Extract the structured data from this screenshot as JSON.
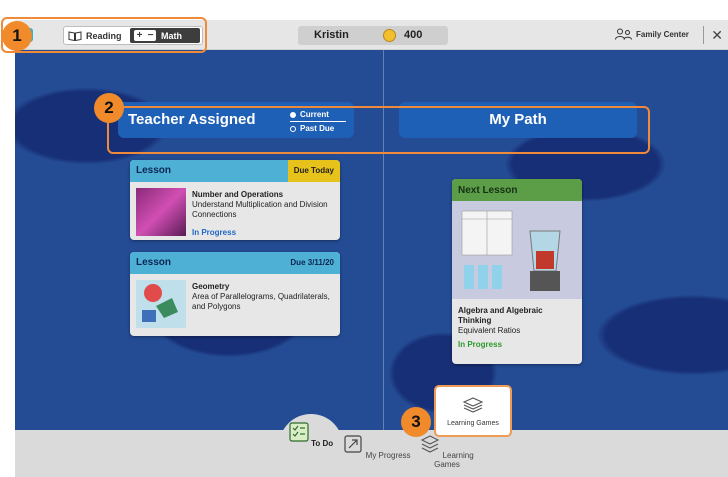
{
  "topbar": {
    "subjects": [
      {
        "label": "Reading",
        "icon": "book-icon",
        "selected": false
      },
      {
        "label": "Math",
        "icon": "plus-minus-icon",
        "selected": true
      }
    ],
    "user_name": "Kristin",
    "coins": "400",
    "family_center_label": "Family Center",
    "close_icon": "close-icon"
  },
  "tabs": {
    "assigned": {
      "label": "Teacher Assigned",
      "options": [
        {
          "label": "Current",
          "selected": true
        },
        {
          "label": "Past Due",
          "selected": false
        }
      ]
    },
    "my_path": {
      "label": "My Path"
    }
  },
  "lessons": [
    {
      "header": "Lesson",
      "due": "Due Today",
      "title": "Number and Operations",
      "subtitle": "Understand Multiplication and Division Connections",
      "status": "In Progress"
    },
    {
      "header": "Lesson",
      "due": "Due 3/11/20",
      "title": "Geometry",
      "subtitle": "Area of Parallelograms, Quadrilaterals, and Polygons",
      "status": ""
    }
  ],
  "next_lesson": {
    "header": "Next Lesson",
    "title": "Algebra and Algebraic Thinking",
    "subtitle": "Equivalent Ratios",
    "status": "In Progress"
  },
  "bottom_nav": [
    {
      "label": "To Do",
      "icon": "todo-list-icon",
      "active": true
    },
    {
      "label": "My Progress",
      "icon": "progress-arrow-icon",
      "active": false
    },
    {
      "label": "Learning Games",
      "icon": "games-icon",
      "active": false
    }
  ],
  "games_popup": {
    "label": "Learning Games"
  },
  "callouts": [
    "1",
    "2",
    "3"
  ],
  "colors": {
    "accent_orange": "#f08a2b",
    "board_blue": "#244c95",
    "tab_blue": "#1e60b5",
    "lesson_head": "#4fb0d6",
    "due_yellow": "#e7c21a",
    "next_green": "#5c9e48"
  }
}
